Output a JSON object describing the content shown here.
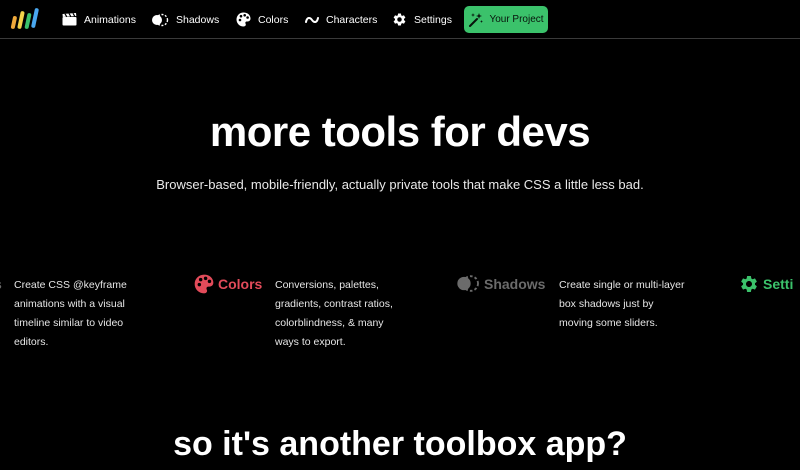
{
  "nav": {
    "items": [
      {
        "label": "Animations",
        "icon": "clapperboard-icon"
      },
      {
        "label": "Shadows",
        "icon": "shadow-circle-icon"
      },
      {
        "label": "Colors",
        "icon": "palette-icon"
      },
      {
        "label": "Characters",
        "icon": "tilde-icon"
      },
      {
        "label": "Settings",
        "icon": "gear-icon"
      }
    ],
    "project_button": "Your Project"
  },
  "hero": {
    "title": "more tools for devs",
    "subtitle": "Browser-based, mobile-friendly, actually private tools that make CSS a little less bad."
  },
  "tools": [
    {
      "name": "s",
      "description": [
        "Create CSS @keyframe",
        "animations with a visual",
        "timeline similar to video",
        "editors."
      ]
    },
    {
      "name": "Colors",
      "color": "#e24b5a",
      "description": [
        "Conversions, palettes,",
        "gradients, contrast ratios,",
        "colorblindness, & many",
        "ways to export."
      ]
    },
    {
      "name": "Shadows",
      "color": "#6b6b6b",
      "description": [
        "Create single or multi-layer",
        "box shadows just by",
        "moving some sliders."
      ]
    },
    {
      "name": "Setti",
      "color": "#3bc26b"
    }
  ],
  "section": {
    "title": "so it's another toolbox app?"
  },
  "colors": {
    "background": "#000000",
    "accent_green": "#3bc26b",
    "colors_red": "#e24b5a",
    "shadows_gray": "#6b6b6b"
  }
}
